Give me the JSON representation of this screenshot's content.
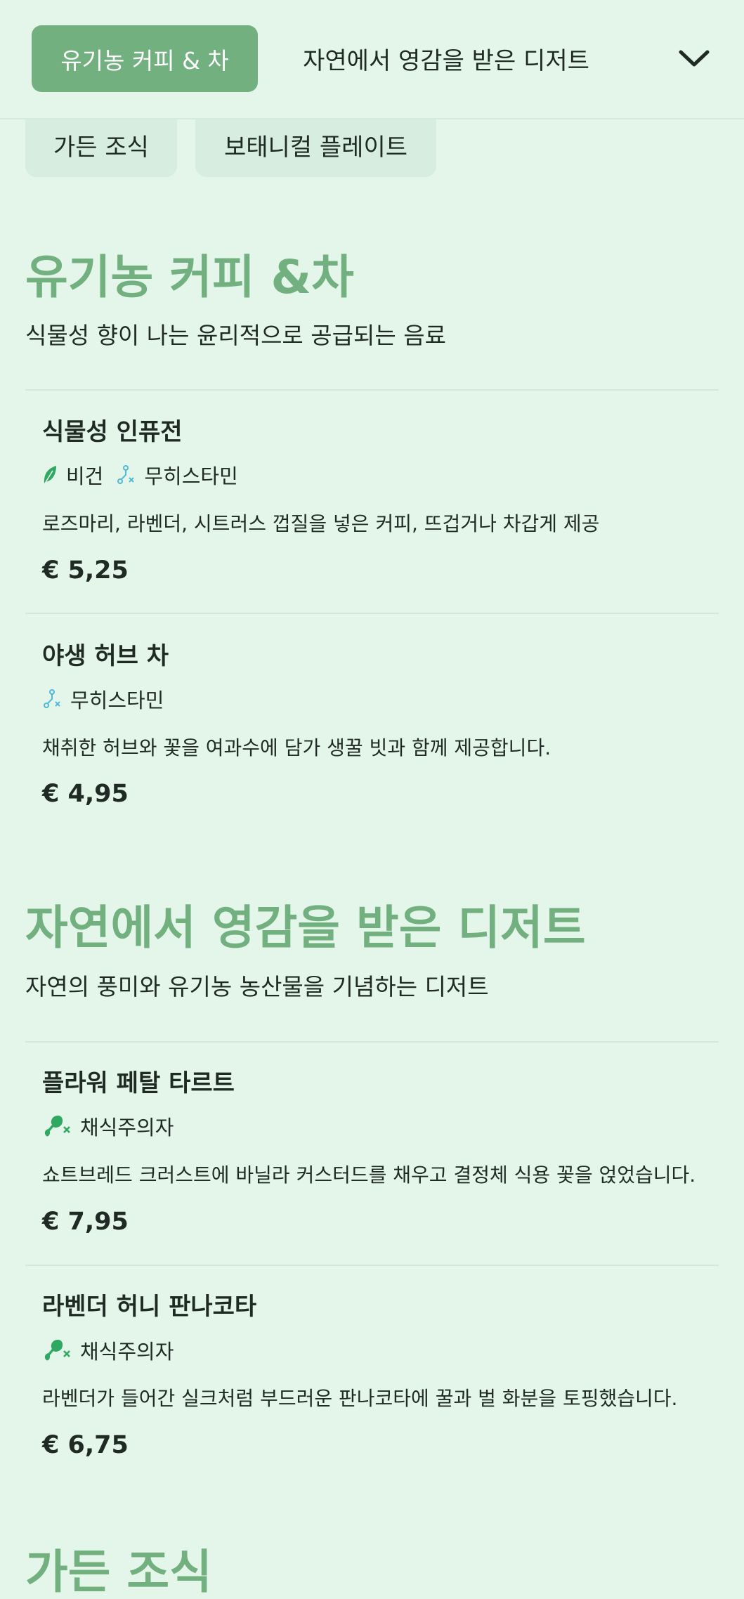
{
  "nav": {
    "active_tab": "유기농 커피 & 차",
    "tab_2": "자연에서 영감을 받은 디저트",
    "chips": [
      "가든 조식",
      "보태니컬 플레이트"
    ]
  },
  "sections": [
    {
      "title": "유기농 커피 &차",
      "subtitle": "식물성 향이 나는 윤리적으로 공급되는 음료",
      "items": [
        {
          "name": "식물성 인퓨전",
          "tags": [
            "비건",
            "무히스타민"
          ],
          "description": "로즈마리, 라벤더, 시트러스 껍질을 넣은 커피, 뜨겁거나 차갑게 제공",
          "price": "€ 5,25"
        },
        {
          "name": "야생 허브 차",
          "tags": [
            "무히스타민"
          ],
          "description": "채취한 허브와 꽃을 여과수에 담가 생꿀 빗과 함께 제공합니다.",
          "price": "€ 4,95"
        }
      ]
    },
    {
      "title": "자연에서 영감을 받은 디저트",
      "subtitle": "자연의 풍미와 유기농 농산물을 기념하는 디저트",
      "items": [
        {
          "name": "플라워 페탈 타르트",
          "tags": [
            "채식주의자"
          ],
          "description": "쇼트브레드 크러스트에 바닐라 커스터드를 채우고 결정체 식용 꽃을 얹었습니다.",
          "price": "€ 7,95"
        },
        {
          "name": "라벤더 허니 판나코타",
          "tags": [
            "채식주의자"
          ],
          "description": "라벤더가 들어간 실크처럼 부드러운 판나코타에 꿀과 벌 화분을 토핑했습니다.",
          "price": "€ 6,75"
        }
      ]
    }
  ],
  "next_section_title": "가든 조식",
  "colors": {
    "accent": "#72b07f",
    "background": "#e4f6ea",
    "vegan_icon": "#2fa862",
    "histamine_icon": "#4fb8d8",
    "vegetarian_icon": "#2fa862"
  }
}
